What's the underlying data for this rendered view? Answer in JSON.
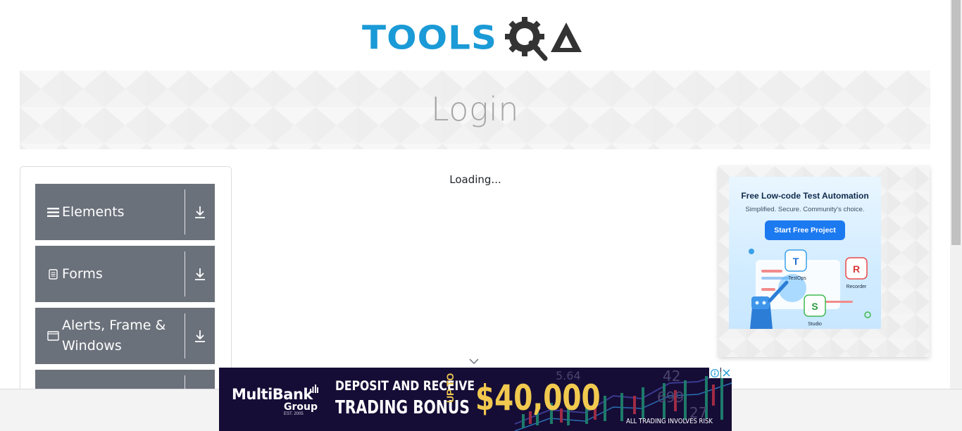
{
  "logo": {
    "text_tools": "TOOLS",
    "text_qa": "QA",
    "alt": "ToolsQA"
  },
  "banner": {
    "title": "Login"
  },
  "sidebar": {
    "groups": [
      {
        "label": "Elements",
        "icon": "hamburger-icon"
      },
      {
        "label": "Forms",
        "icon": "document-icon"
      },
      {
        "label": "Alerts, Frame & Windows",
        "icon": "window-icon"
      },
      {
        "label": "",
        "icon": ""
      }
    ]
  },
  "main": {
    "status": "Loading..."
  },
  "ad_right": {
    "headline": "Free Low-code Test Automation",
    "subheadline": "Simplified. Secure. Community's choice.",
    "cta": "Start Free Project",
    "products": [
      "TestOps",
      "Recorder",
      "Studio"
    ]
  },
  "ad_bottom": {
    "brand": "MultiBank",
    "brand_sub": "Group",
    "est": "EST. 2005",
    "line1": "DEPOSIT AND RECEIVE",
    "line2": "TRADING BONUS",
    "upto": "UP TO",
    "amount": "$40,000",
    "disclaimer": "ALL TRADING INVOLVES RISK",
    "ticker_numbers": [
      "42",
      "5.64",
      "699",
      "27"
    ]
  },
  "colors": {
    "brand_blue": "#1a9ad6",
    "gear_dark": "#333333",
    "sidebar_group": "#6b717b",
    "ad_gold": "#f1c94f"
  }
}
